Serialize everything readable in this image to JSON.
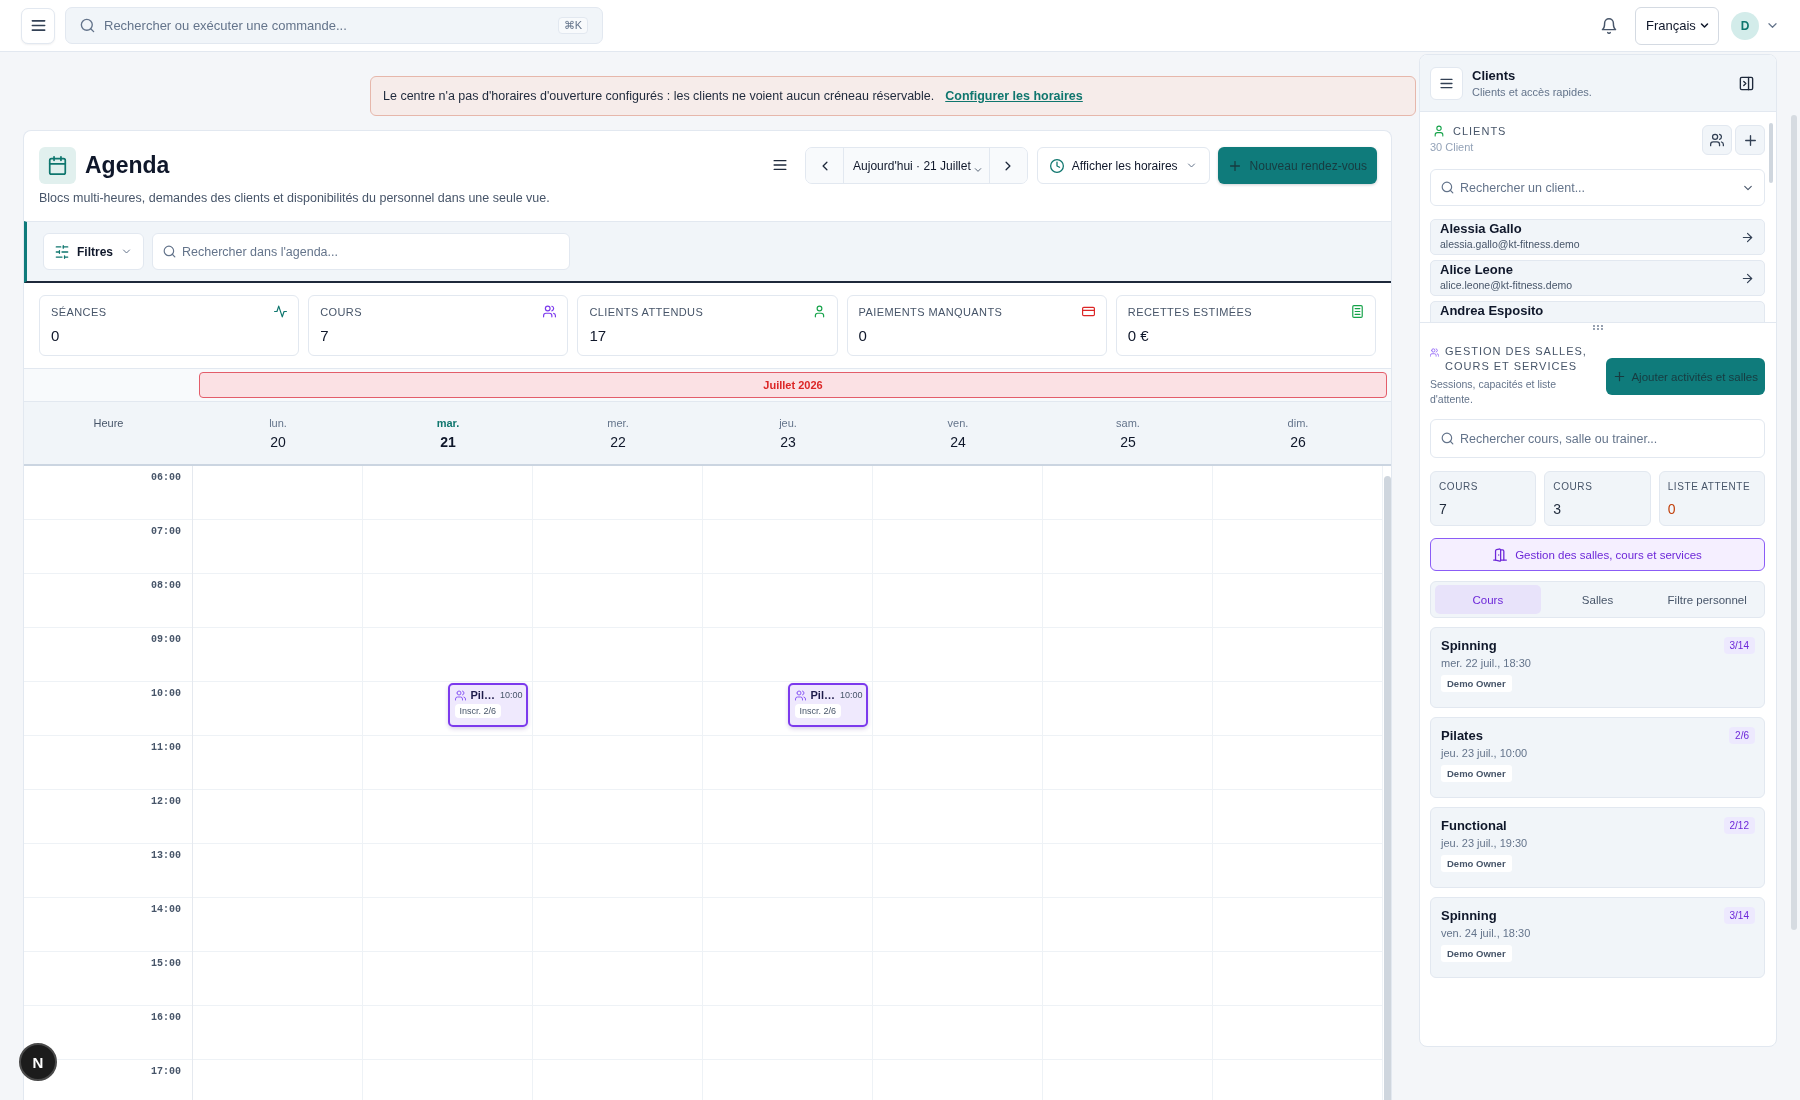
{
  "topbar": {
    "search": {
      "placeholder": "Rechercher ou exécuter une commande...",
      "shortcut": "⌘K"
    },
    "language": "Français",
    "avatar": "D"
  },
  "banner": {
    "message": "Le centre n'a pas d'horaires d'ouverture configurés : les clients ne voient aucun créneau réservable.",
    "link": "Configurer les horaires"
  },
  "agenda": {
    "title": "Agenda",
    "subtitle": "Blocs multi-heures, demandes des clients et disponibilités du personnel dans une seule vue.",
    "date_label": "Aujourd'hui · 21 Juillet",
    "hours_button": "Afficher les horaires",
    "new_button": "Nouveau rendez-vous",
    "filters_button": "Filtres",
    "search": {
      "placeholder": "Rechercher dans l'agenda..."
    },
    "stats": [
      {
        "kind": "sessions",
        "label": "SÉANCES",
        "value": "0"
      },
      {
        "kind": "courses",
        "label": "COURS",
        "value": "7"
      },
      {
        "kind": "clients",
        "label": "CLIENTS ATTENDUS",
        "value": "17"
      },
      {
        "kind": "payments",
        "label": "PAIEMENTS MANQUANTS",
        "value": "0"
      },
      {
        "kind": "revenue",
        "label": "RECETTES ESTIMÉES",
        "value": "0 €"
      }
    ]
  },
  "calendar": {
    "month": "Juillet 2026",
    "hour_heading": "Heure",
    "days": [
      {
        "name": "lun.",
        "date": "20",
        "today": false
      },
      {
        "name": "mar.",
        "date": "21",
        "today": true,
        "events": [
          {
            "title": "Pil…",
            "time": "10:00",
            "enrolment": "Inscr. 2/6"
          }
        ]
      },
      {
        "name": "mer.",
        "date": "22",
        "today": false
      },
      {
        "name": "jeu.",
        "date": "23",
        "today": false,
        "events": [
          {
            "title": "Pil…",
            "time": "10:00",
            "enrolment": "Inscr. 2/6"
          }
        ]
      },
      {
        "name": "ven.",
        "date": "24",
        "today": false
      },
      {
        "name": "sam.",
        "date": "25",
        "today": false
      },
      {
        "name": "dim.",
        "date": "26",
        "today": false
      }
    ],
    "hours": [
      "06:00",
      "07:00",
      "08:00",
      "09:00",
      "10:00",
      "11:00",
      "12:00",
      "13:00",
      "14:00",
      "15:00",
      "16:00",
      "17:00"
    ]
  },
  "panel": {
    "title": "Clients",
    "subtitle": "Clients et accès rapides.",
    "clients": {
      "heading": "CLIENTS",
      "count": "30 Client",
      "search": {
        "placeholder": "Rechercher un client..."
      },
      "items": [
        {
          "name": "Alessia Gallo",
          "email": "alessia.gallo@kt-fitness.demo"
        },
        {
          "name": "Alice Leone",
          "email": "alice.leone@kt-fitness.demo"
        },
        {
          "name": "Andrea Esposito"
        }
      ]
    },
    "rooms": {
      "heading": "GESTION DES SALLES, COURS ET SERVICES",
      "description": "Sessions, capacités et liste d'attente.",
      "add_button": "Ajouter activités et salles",
      "search": {
        "placeholder": "Rechercher cours, salle ou trainer..."
      },
      "stats": [
        {
          "label": "COURS",
          "value": "7",
          "color": "#1e293b"
        },
        {
          "label": "COURS",
          "value": "3",
          "color": "#1e293b"
        },
        {
          "label": "LISTE ATTENTE",
          "value": "0",
          "color": "#c2410c"
        }
      ],
      "manage_button": "Gestion des salles, cours et services",
      "tabs": [
        {
          "label": "Cours",
          "selected": true
        },
        {
          "label": "Salles",
          "selected": false
        },
        {
          "label": "Filtre personnel",
          "selected": false
        }
      ],
      "courses": [
        {
          "title": "Spinning",
          "when": "mer. 22 juil., 18:30",
          "trainer": "Demo Owner",
          "capacity": "3/14"
        },
        {
          "title": "Pilates",
          "when": "jeu. 23 juil., 10:00",
          "trainer": "Demo Owner",
          "capacity": "2/6"
        },
        {
          "title": "Functional",
          "when": "jeu. 23 juil., 19:30",
          "trainer": "Demo Owner",
          "capacity": "2/12"
        },
        {
          "title": "Spinning",
          "when": "ven. 24 juil., 18:30",
          "trainer": "Demo Owner",
          "capacity": "3/14"
        }
      ]
    }
  },
  "dev_badge": "N"
}
